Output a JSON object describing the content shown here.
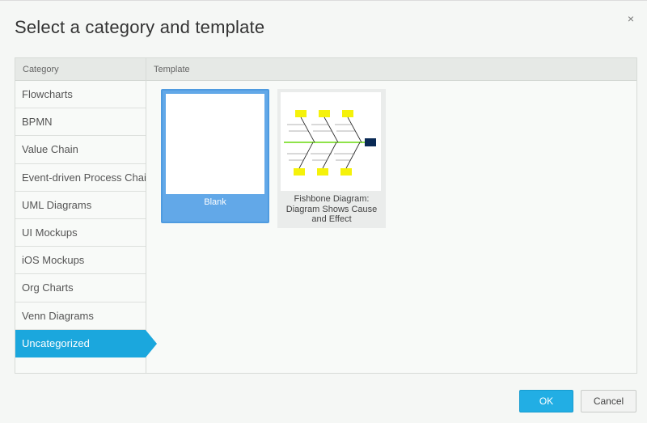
{
  "dialog": {
    "title": "Select a category and template",
    "close_symbol": "×"
  },
  "columns": {
    "category_header": "Category",
    "template_header": "Template"
  },
  "categories": [
    {
      "label": "Flowcharts",
      "selected": false
    },
    {
      "label": "BPMN",
      "selected": false
    },
    {
      "label": "Value Chain",
      "selected": false
    },
    {
      "label": "Event-driven Process Chain",
      "selected": false
    },
    {
      "label": "UML Diagrams",
      "selected": false
    },
    {
      "label": "UI Mockups",
      "selected": false
    },
    {
      "label": "iOS Mockups",
      "selected": false
    },
    {
      "label": "Org Charts",
      "selected": false
    },
    {
      "label": "Venn Diagrams",
      "selected": false
    },
    {
      "label": "Uncategorized",
      "selected": true
    }
  ],
  "templates": [
    {
      "label": "Blank",
      "selected": true
    },
    {
      "label": "Fishbone Diagram: Diagram Shows Cause and Effect",
      "selected": false
    }
  ],
  "buttons": {
    "ok": "OK",
    "cancel": "Cancel"
  },
  "colors": {
    "accent": "#1ba7dd",
    "selected_template": "#62a8e8",
    "ok_button": "#22aee4"
  },
  "icons": {
    "close": "close-icon",
    "fishbone_thumbnail": "fishbone-diagram-icon"
  }
}
